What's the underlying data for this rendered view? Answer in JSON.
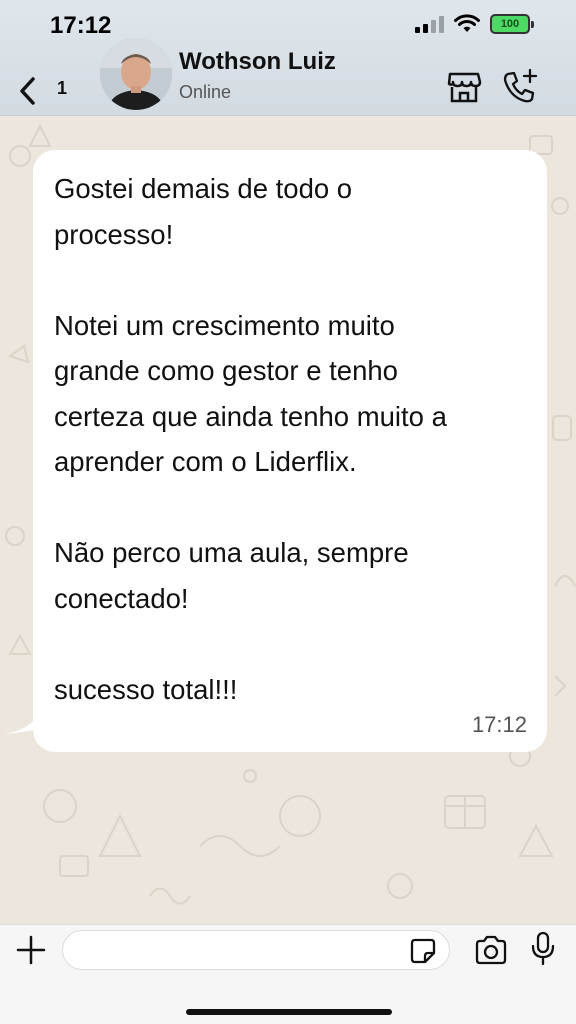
{
  "status_bar": {
    "time": "17:12",
    "battery": "100"
  },
  "header": {
    "unread_count": "1",
    "contact_name": "Wothson Luiz",
    "contact_status": "Online",
    "icons": [
      "back-chevron-icon",
      "store-icon",
      "add-call-icon"
    ]
  },
  "message": {
    "text": "Gostei demais de todo o\nprocesso!\n\nNotei um crescimento muito\ngrande como gestor e tenho\ncerteza que ainda tenho muito a\naprender com o Liderflix.\n\nNão perco uma aula, sempre\nconectado!\n\nsucesso total!!!",
    "time": "17:12"
  },
  "input_bar": {
    "value": "",
    "icons": [
      "plus-icon",
      "sticker-icon",
      "camera-icon",
      "mic-icon"
    ]
  },
  "colors": {
    "header_bg": "#d8dfe5",
    "chat_bg": "#ece6dd",
    "bubble_bg": "#ffffff",
    "battery_green": "#4cd964"
  }
}
